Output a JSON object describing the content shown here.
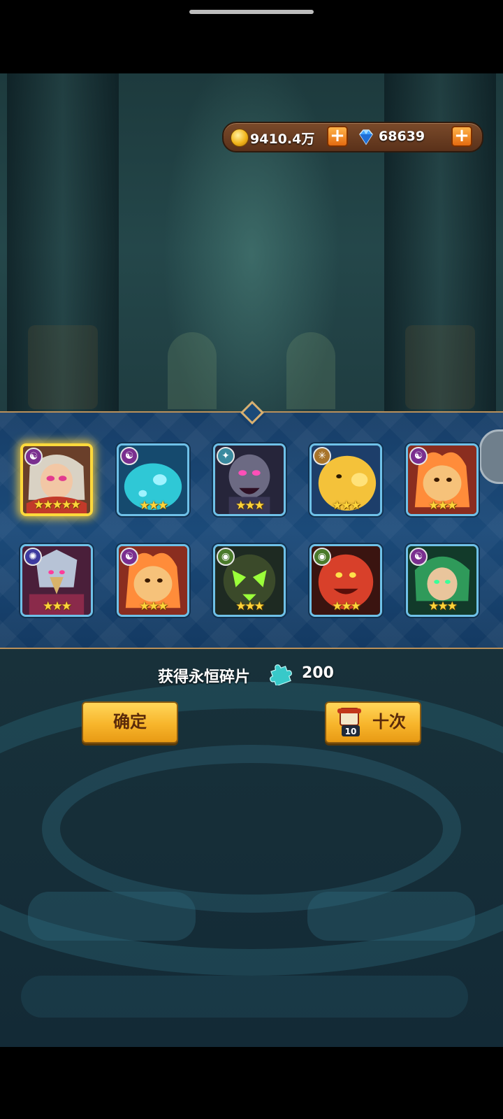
{
  "currency": {
    "gold": "9410.4万",
    "gems": "68639",
    "gold_icon": "coin-icon",
    "gem_icon": "diamond-icon"
  },
  "heroes": [
    {
      "stars": "★★★★★",
      "element": "shadow",
      "legendary": true
    },
    {
      "stars": "★★★",
      "element": "shadow"
    },
    {
      "stars": "★★★",
      "element": "storm"
    },
    {
      "stars": "★★★",
      "element": "light"
    },
    {
      "stars": "★★★",
      "element": "shadow"
    },
    {
      "stars": "★★★",
      "element": "void"
    },
    {
      "stars": "★★★",
      "element": "shadow"
    },
    {
      "stars": "★★★",
      "element": "nature"
    },
    {
      "stars": "★★★",
      "element": "nature"
    },
    {
      "stars": "★★★",
      "element": "shadow"
    }
  ],
  "reward": {
    "label": "获得永恒碎片",
    "amount": "200",
    "icon": "puzzle-piece-icon"
  },
  "buttons": {
    "confirm": "确定",
    "ten_draw": "十次",
    "ticket_count": "10"
  },
  "colors": {
    "accent_gold": "#f7b52b",
    "panel_blue": "#1b4a79",
    "card_border": "#6fc1e8",
    "legend_glow": "#ffd93b"
  }
}
